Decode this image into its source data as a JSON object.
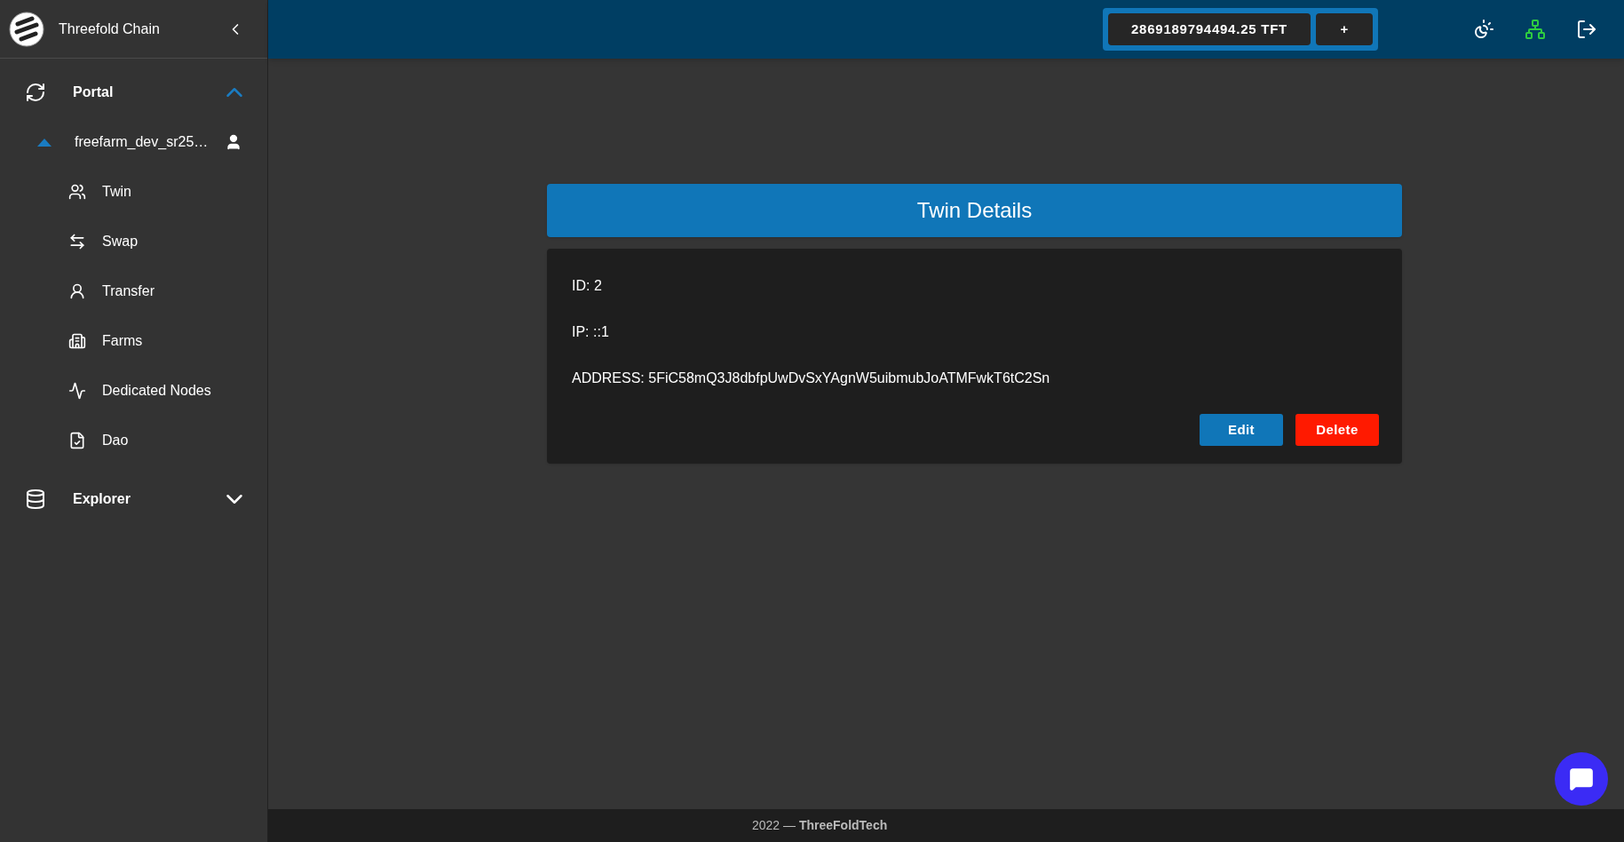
{
  "sidebar": {
    "title": "Threefold Chain",
    "groups": [
      {
        "label": "Portal",
        "expanded": true,
        "account": {
          "label": "freefarm_dev_sr25…",
          "expanded": true,
          "items": [
            {
              "label": "Twin"
            },
            {
              "label": "Swap"
            },
            {
              "label": "Transfer"
            },
            {
              "label": "Farms"
            },
            {
              "label": "Dedicated Nodes"
            },
            {
              "label": "Dao"
            }
          ]
        }
      },
      {
        "label": "Explorer",
        "expanded": false
      }
    ]
  },
  "topbar": {
    "balance": "2869189794494.25 TFT",
    "add": "+"
  },
  "card": {
    "title": "Twin Details",
    "fields": [
      "ID: 2",
      "IP: ::1",
      "ADDRESS: 5FiC58mQ3J8dbfpUwDvSxYAgnW5uibmubJoATMFwkT6tC2Sn"
    ],
    "buttons": [
      {
        "label": "Edit",
        "kind": "primary"
      },
      {
        "label": "Delete",
        "kind": "danger"
      }
    ]
  },
  "footer": "2022 — **ThreeFoldTech**"
}
